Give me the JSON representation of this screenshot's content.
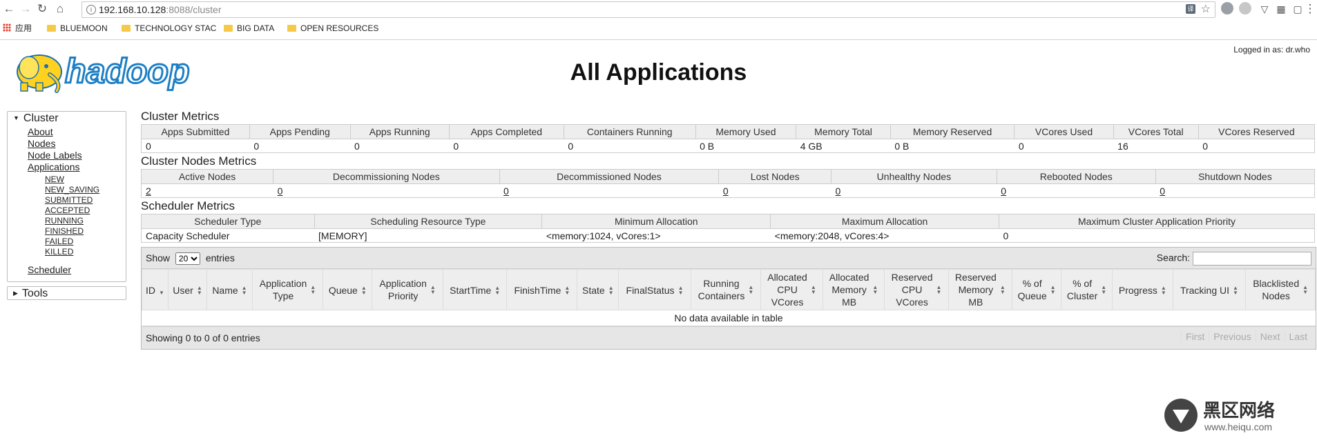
{
  "browser": {
    "url_host": "192.168.10.128",
    "url_rest": ":8088/cluster",
    "translate_badge": "译",
    "bookmarks": [
      "应用",
      "BLUEMOON",
      "TECHNOLOGY STAC",
      "BIG DATA",
      "OPEN RESOURCES"
    ]
  },
  "header": {
    "logo_text": "hadoop",
    "title": "All Applications",
    "logged_in": "Logged in as: dr.who"
  },
  "sidebar": {
    "cluster_label": "Cluster",
    "links": [
      "About",
      "Nodes",
      "Node Labels",
      "Applications"
    ],
    "app_states": [
      "NEW",
      "NEW_SAVING",
      "SUBMITTED",
      "ACCEPTED",
      "RUNNING",
      "FINISHED",
      "FAILED",
      "KILLED"
    ],
    "scheduler": "Scheduler",
    "tools_label": "Tools"
  },
  "cluster_metrics": {
    "title": "Cluster Metrics",
    "headers": [
      "Apps Submitted",
      "Apps Pending",
      "Apps Running",
      "Apps Completed",
      "Containers Running",
      "Memory Used",
      "Memory Total",
      "Memory Reserved",
      "VCores Used",
      "VCores Total",
      "VCores Reserved"
    ],
    "values": [
      "0",
      "0",
      "0",
      "0",
      "0",
      "0 B",
      "4 GB",
      "0 B",
      "0",
      "16",
      "0"
    ]
  },
  "nodes_metrics": {
    "title": "Cluster Nodes Metrics",
    "headers": [
      "Active Nodes",
      "Decommissioning Nodes",
      "Decommissioned Nodes",
      "Lost Nodes",
      "Unhealthy Nodes",
      "Rebooted Nodes",
      "Shutdown Nodes"
    ],
    "values": [
      "2",
      "0",
      "0",
      "0",
      "0",
      "0",
      "0"
    ]
  },
  "scheduler_metrics": {
    "title": "Scheduler Metrics",
    "headers": [
      "Scheduler Type",
      "Scheduling Resource Type",
      "Minimum Allocation",
      "Maximum Allocation",
      "Maximum Cluster Application Priority"
    ],
    "values": [
      "Capacity Scheduler",
      "[MEMORY]",
      "<memory:1024, vCores:1>",
      "<memory:2048, vCores:4>",
      "0"
    ]
  },
  "apps_table": {
    "show_label": "Show",
    "entries_label": "entries",
    "page_size": "20",
    "search_label": "Search:",
    "columns": [
      [
        "ID"
      ],
      [
        "User"
      ],
      [
        "Name"
      ],
      [
        "Application",
        "Type"
      ],
      [
        "Queue"
      ],
      [
        "Application",
        "Priority"
      ],
      [
        "StartTime"
      ],
      [
        "FinishTime"
      ],
      [
        "State"
      ],
      [
        "FinalStatus"
      ],
      [
        "Running",
        "Containers"
      ],
      [
        "Allocated",
        "CPU",
        "VCores"
      ],
      [
        "Allocated",
        "Memory",
        "MB"
      ],
      [
        "Reserved",
        "CPU",
        "VCores"
      ],
      [
        "Reserved",
        "Memory",
        "MB"
      ],
      [
        "% of",
        "Queue"
      ],
      [
        "% of",
        "Cluster"
      ],
      [
        "Progress"
      ],
      [
        "Tracking UI"
      ],
      [
        "Blacklisted",
        "Nodes"
      ]
    ],
    "empty_message": "No data available in table",
    "info": "Showing 0 to 0 of 0 entries",
    "pager": [
      "First",
      "Previous",
      "Next",
      "Last"
    ]
  },
  "watermark": {
    "text": "黑区网络",
    "url": "www.heiqu.com"
  },
  "colors": {
    "logo_yellow": "#ffd21f",
    "logo_blue": "#1d7fc4",
    "header_bg": "#eeeeee"
  }
}
